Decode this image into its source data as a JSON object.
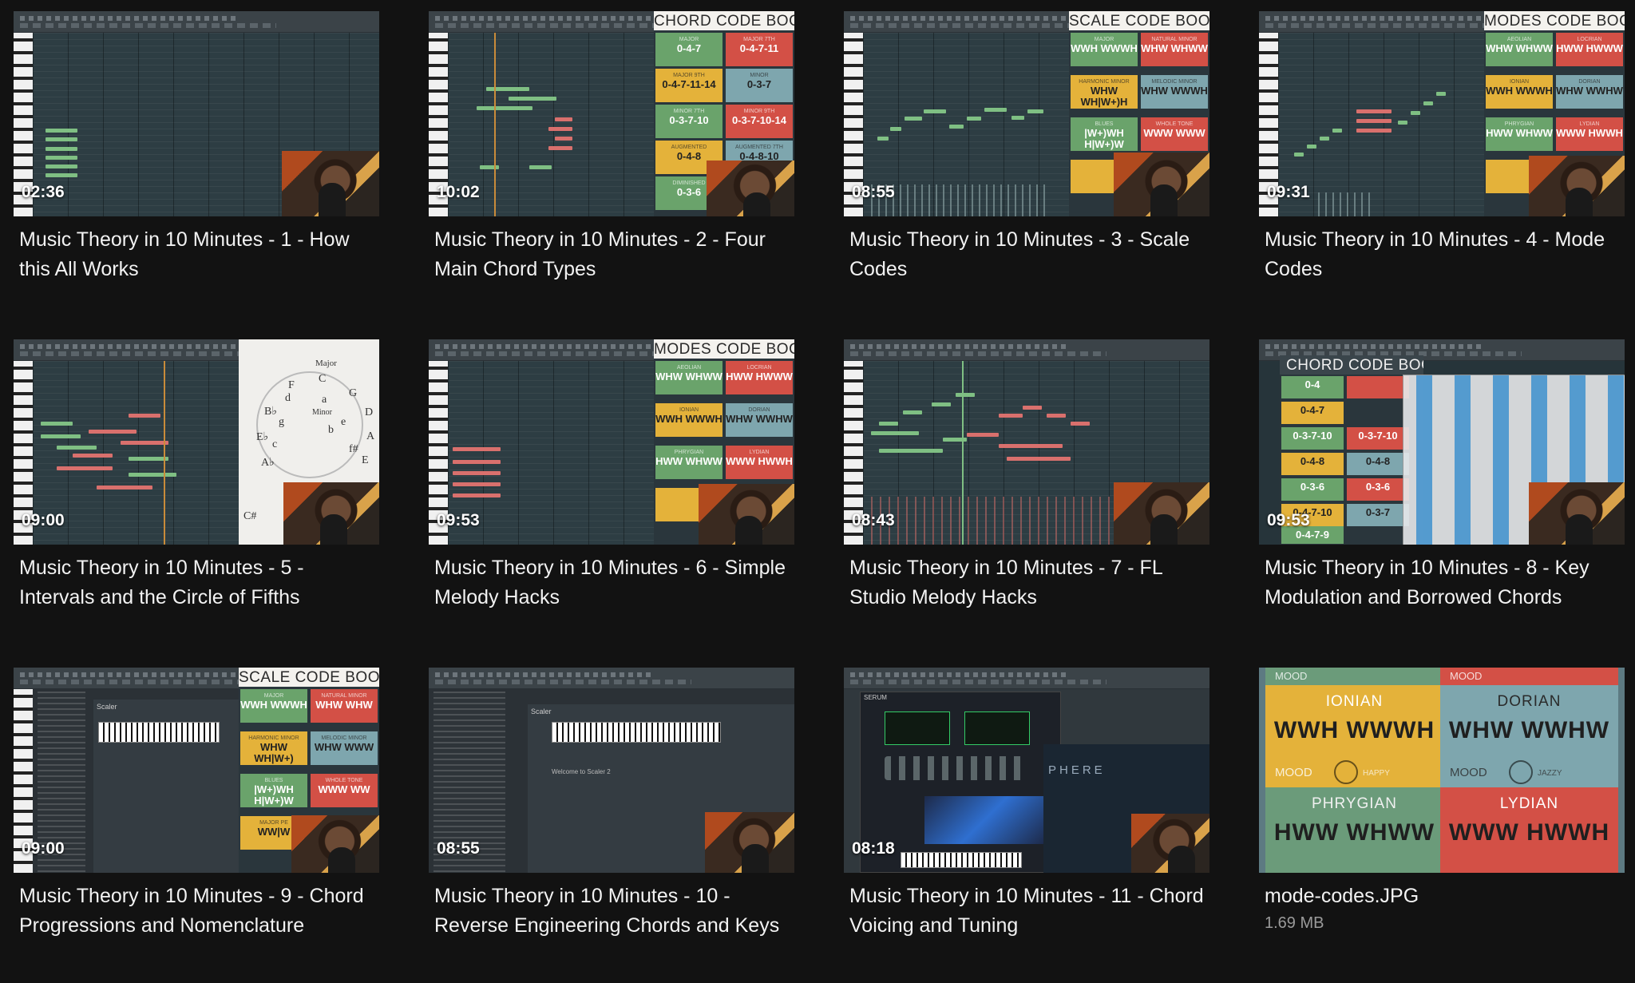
{
  "tiles": [
    {
      "duration": "02:36",
      "title": "Music Theory in 10 Minutes - 1 - How this All Works"
    },
    {
      "duration": "10:02",
      "title": "Music Theory in 10 Minutes - 2 - Four Main Chord Types",
      "panel_title": "CHORD CODE BOOK"
    },
    {
      "duration": "08:55",
      "title": "Music Theory in 10 Minutes - 3 - Scale Codes",
      "panel_title": "SCALE CODE BOOK"
    },
    {
      "duration": "09:31",
      "title": "Music Theory in 10 Minutes - 4 - Mode Codes",
      "panel_title": "MODES CODE BOOK"
    },
    {
      "duration": "09:00",
      "title": "Music Theory in 10 Minutes - 5 - Intervals and the Circle of Fifths"
    },
    {
      "duration": "09:53",
      "title": "Music Theory in 10 Minutes - 6 - Simple Melody Hacks",
      "panel_title": "MODES CODE BOOK"
    },
    {
      "duration": "08:43",
      "title": "Music Theory in 10 Minutes - 7 - FL Studio Melody Hacks"
    },
    {
      "duration": "09:53",
      "title": "Music Theory in 10 Minutes - 8 - Key Modulation and Borrowed Chords",
      "panel_title": "CHORD CODE BOOK"
    },
    {
      "duration": "09:00",
      "title": "Music Theory in 10 Minutes - 9 - Chord Progressions and Nomenclature",
      "panel_title": "SCALE CODE BOOK"
    },
    {
      "duration": "08:55",
      "title": "Music Theory in 10 Minutes - 10 - Reverse Engineering Chords and Keys"
    },
    {
      "duration": "08:18",
      "title": "Music Theory in 10 Minutes - 11 - Chord Voicing and Tuning"
    },
    {
      "duration": "",
      "title": "mode-codes.JPG",
      "subtitle": "1.69 MB"
    }
  ],
  "chord_cells": [
    "0-4-7",
    "0-4-7-11",
    "0-4-7-11-14",
    "0-3-7",
    "0-3-7-10",
    "0-3-7-10-14",
    "0-4-8",
    "0-4-8-10",
    "0-3-6",
    "0-4-7"
  ],
  "chord_small": [
    "MAJOR",
    "MAJOR 7TH",
    "MAJOR 9TH",
    "MINOR",
    "MINOR 7TH",
    "MINOR 9TH",
    "AUGMENTED",
    "AUGMENTED 7TH",
    "DIMINISHED",
    ""
  ],
  "scale_cells": [
    "WWH WWWH",
    "WHW WHWW",
    "WHW WH|W+)H",
    "WHW WWWH",
    "|W+)WH H|W+)W",
    "WWW WWW"
  ],
  "scale_small": [
    "MAJOR",
    "NATURAL MINOR",
    "HARMONIC MINOR",
    "MELODIC MINOR",
    "BLUES",
    "WHOLE TONE"
  ],
  "mode_cells": [
    "WHW WHWW",
    "HWW HWWW",
    "WWH WWWH",
    "WHW WWHW",
    "HWW WHWW",
    "WWW HWWH"
  ],
  "mode_small": [
    "AEOLIAN",
    "LOCRIAN",
    "IONIAN",
    "DORIAN",
    "PHRYGIAN",
    "LYDIAN"
  ],
  "mode_cells_6": [
    "WHW WHWW",
    "HWW HWWW",
    "WWH WWWH",
    "WHW WWHW",
    "HWW WHWW",
    "WWW HWWH"
  ],
  "mode_small_6": [
    "AEOLIAN",
    "LOCRIAN",
    "IONIAN",
    "DORIAN",
    "PHRYGIAN",
    "LYDIAN"
  ],
  "chord_cells_8": [
    "0-4",
    "0-4-7",
    "0-3-7-10",
    "0-3-7-10",
    "0-4-8",
    "0-4-8",
    "0-3-6",
    "0-3-6",
    "0-4-7-10",
    "0-3-7",
    "0-4-7-9"
  ],
  "scale_cells_9": [
    "WWH WWWH",
    "WHW WHW",
    "WHW WH|W+)",
    "WHW WWW",
    "|W+)WH H|W+)W",
    "WWW WW",
    "WW|W"
  ],
  "scale_small_9": [
    "MAJOR",
    "NATURAL MINOR",
    "HARMONIC MINOR",
    "MELODIC MINOR",
    "BLUES",
    "WHOLE TONE",
    "MAJOR PE"
  ],
  "wheel_labels": [
    "Major",
    "C",
    "G",
    "D",
    "A",
    "E",
    "F",
    "B♭",
    "E♭",
    "A♭",
    "C#",
    "f#",
    "a",
    "e",
    "b",
    "d",
    "g",
    "c",
    "Minor"
  ],
  "mode_big": [
    {
      "name": "IONIAN",
      "code": "WWH WWWH",
      "mood": "MOOD",
      "mood_word": "HAPPY"
    },
    {
      "name": "DORIAN",
      "code": "WHW WWHW",
      "mood": "MOOD",
      "mood_word": "JAZZY"
    },
    {
      "name": "PHRYGIAN",
      "code": "HWW WHWW",
      "mood": "MOOD",
      "mood_word": ""
    },
    {
      "name": "LYDIAN",
      "code": "WWW HWWH",
      "mood": "MOOD",
      "mood_word": ""
    }
  ],
  "mode_big_top": [
    "MOOD",
    "MOOD"
  ],
  "synth_label": "SERUM",
  "synth_wave": "PHERE",
  "scaler_label": "Scaler",
  "scaler_welcome": "Welcome to Scaler 2",
  "colors": {
    "background": "#121212",
    "title": "#f2f2f2",
    "subtitle": "#9a9a9a",
    "yellow": "#e4b23a",
    "red": "#d35046",
    "blue": "#7ea6ae",
    "green": "#6aa36b"
  }
}
